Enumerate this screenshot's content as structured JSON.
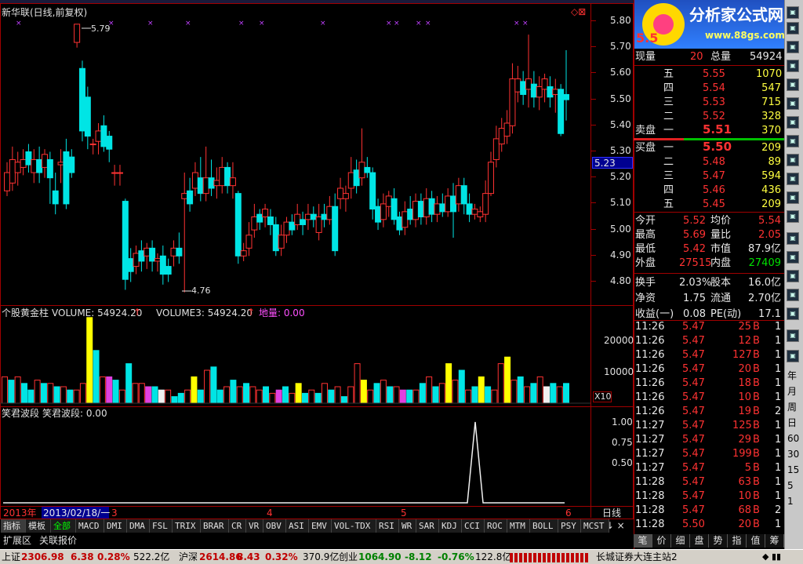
{
  "window": {
    "title": "新华联(日线,前复权)",
    "top_title": "分析家公式网"
  },
  "logo": {
    "title": "分析家公式网",
    "url": "www.88gs.com"
  },
  "price_chart": {
    "axis": [
      "5.80",
      "5.70",
      "5.60",
      "5.50",
      "5.40",
      "5.30",
      "5.20",
      "5.10",
      "5.00",
      "4.90",
      "4.80"
    ],
    "current_price_tag": "5.23",
    "high_label": "5.79",
    "low_label": "4.76"
  },
  "volume_panel": {
    "label_1": "个股黄金柱",
    "label_2": "VOLUME: 54924.20",
    "label_3": "VOLUME3: 54924.20",
    "label_4": "地量: 0.00",
    "axis": [
      "20000",
      "10000"
    ],
    "multiplier": "X10"
  },
  "indicator_panel": {
    "label_1": "笑君波段",
    "label_2": "笑君波段: 0.00",
    "axis": [
      "1.00",
      "0.75",
      "0.50"
    ]
  },
  "date_bar": {
    "year": "2013年",
    "cursor_date": "2013/02/18/一",
    "months": [
      "3",
      "4",
      "5",
      "6"
    ],
    "period": "日线"
  },
  "bottom_tabs": {
    "left": [
      "指标",
      "模板"
    ],
    "indicators": [
      "全部",
      "MACD",
      "DMI",
      "DMA",
      "FSL",
      "TRIX",
      "BRAR",
      "CR",
      "VR",
      "OBV",
      "ASI",
      "EMV",
      "VOL-TDX",
      "RSI",
      "WR",
      "SAR",
      "KDJ",
      "CCI",
      "ROC",
      "MTM",
      "BOLL",
      "PSY",
      "MCST"
    ],
    "row2": [
      "扩展区",
      "关联报价"
    ]
  },
  "quote": {
    "price_big": "5.5",
    "now_vol_label": "现量",
    "now_vol": "20",
    "total_vol_label": "总量",
    "total_vol": "54924",
    "sell_label": "卖盘",
    "buy_label": "买盘",
    "asks": [
      {
        "level": "五",
        "price": "5.55",
        "vol": "1070"
      },
      {
        "level": "四",
        "price": "5.54",
        "vol": "547"
      },
      {
        "level": "三",
        "price": "5.53",
        "vol": "715"
      },
      {
        "level": "二",
        "price": "5.52",
        "vol": "328"
      },
      {
        "level": "一",
        "price": "5.51",
        "vol": "370"
      }
    ],
    "bids": [
      {
        "level": "一",
        "price": "5.50",
        "vol": "209"
      },
      {
        "level": "二",
        "price": "5.48",
        "vol": "89"
      },
      {
        "level": "三",
        "price": "5.47",
        "vol": "594"
      },
      {
        "level": "四",
        "price": "5.46",
        "vol": "436"
      },
      {
        "level": "五",
        "price": "5.45",
        "vol": "209"
      }
    ],
    "stats": [
      {
        "l1": "今开",
        "v1": "5.52",
        "l2": "均价",
        "v2": "5.54"
      },
      {
        "l1": "最高",
        "v1": "5.69",
        "l2": "量比",
        "v2": "2.05"
      },
      {
        "l1": "最低",
        "v1": "5.42",
        "l2": "市值",
        "v2": "87.9亿"
      },
      {
        "l1": "外盘",
        "v1": "27515",
        "l2": "内盘",
        "v2": "27409"
      },
      {
        "l1": "换手",
        "v1": "2.03%",
        "l2": "股本",
        "v2": "16.0亿"
      },
      {
        "l1": "净资",
        "v1": "1.75",
        "l2": "流通",
        "v2": "2.70亿"
      },
      {
        "l1": "收益(一)",
        "v1": "0.08",
        "l2": "PE(动)",
        "v2": "17.1"
      }
    ],
    "ticks": [
      {
        "time": "11:26",
        "price": "5.47",
        "vol": "25",
        "side": "B",
        "n": "1"
      },
      {
        "time": "11:26",
        "price": "5.47",
        "vol": "12",
        "side": "B",
        "n": "1"
      },
      {
        "time": "11:26",
        "price": "5.47",
        "vol": "127",
        "side": "B",
        "n": "1"
      },
      {
        "time": "11:26",
        "price": "5.47",
        "vol": "20",
        "side": "B",
        "n": "1"
      },
      {
        "time": "11:26",
        "price": "5.47",
        "vol": "18",
        "side": "B",
        "n": "1"
      },
      {
        "time": "11:26",
        "price": "5.47",
        "vol": "10",
        "side": "B",
        "n": "1"
      },
      {
        "time": "11:26",
        "price": "5.47",
        "vol": "19",
        "side": "B",
        "n": "2"
      },
      {
        "time": "11:27",
        "price": "5.47",
        "vol": "125",
        "side": "B",
        "n": "1"
      },
      {
        "time": "11:27",
        "price": "5.47",
        "vol": "29",
        "side": "B",
        "n": "1"
      },
      {
        "time": "11:27",
        "price": "5.47",
        "vol": "199",
        "side": "B",
        "n": "1"
      },
      {
        "time": "11:27",
        "price": "5.47",
        "vol": "5",
        "side": "B",
        "n": "1"
      },
      {
        "time": "11:28",
        "price": "5.47",
        "vol": "63",
        "side": "B",
        "n": "1"
      },
      {
        "time": "11:28",
        "price": "5.47",
        "vol": "10",
        "side": "B",
        "n": "1"
      },
      {
        "time": "11:28",
        "price": "5.47",
        "vol": "68",
        "side": "B",
        "n": "2"
      },
      {
        "time": "11:28",
        "price": "5.50",
        "vol": "20",
        "side": "B",
        "n": "1"
      }
    ],
    "tabs": [
      "笔",
      "价",
      "细",
      "盘",
      "势",
      "指",
      "值",
      "筹"
    ]
  },
  "side_toolbar": [
    "年",
    "月",
    "周",
    "日",
    "60",
    "30",
    "15",
    "5",
    "1"
  ],
  "status_bar": {
    "sh_label": "上证",
    "sh_val": "2306.98",
    "sh_chg": "6.38",
    "sh_pct": "0.28%",
    "sh_amt": "522.2亿",
    "sz_label": "沪深",
    "sz_val": "2614.86",
    "sz_chg": "8.43",
    "sz_pct": "0.32%",
    "sz_amt": "370.9亿",
    "cy_label": "创业",
    "cy_val": "1064.90",
    "cy_chg": "-8.12",
    "cy_pct": "-0.76%",
    "cy_amt": "122.8亿",
    "broker": "长城证券大连主站2"
  },
  "colors": {
    "up": "#ff3232",
    "down": "#00e5e5",
    "volume_yellow": "#ffff00",
    "border": "#a00000"
  }
}
